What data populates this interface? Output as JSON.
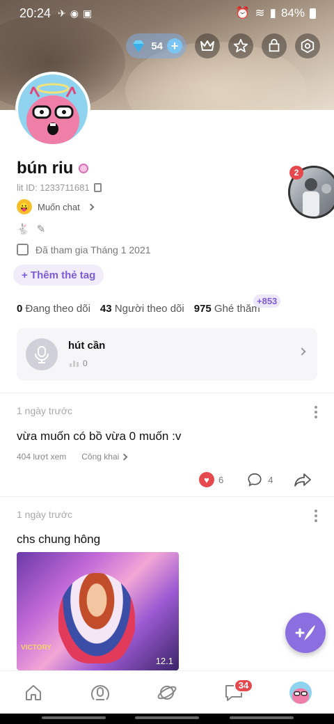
{
  "status_bar": {
    "time": "20:24",
    "battery": "84%"
  },
  "header": {
    "gems": "54"
  },
  "profile": {
    "name": "bún riu",
    "lit_id": "lit ID: 1233711681",
    "mood": "Muốn chat",
    "joined": "Đã tham gia Tháng 1 2021",
    "tag_button": "+ Thêm thẻ tag",
    "stats": {
      "following_count": "0",
      "following_label": "Đang theo dõi",
      "followers_count": "43",
      "followers_label": "Người theo dõi",
      "visits_count": "975",
      "visits_label": "Ghé thăm",
      "visits_new": "+853"
    },
    "story_count": "2"
  },
  "voice": {
    "title": "hút cần",
    "plays": "0"
  },
  "posts": [
    {
      "time": "1 ngày trước",
      "text": "vừa muốn có bồ vừa 0 muốn :v",
      "views": "404 lượt xem",
      "visibility": "Công khai",
      "likes": "6",
      "comments": "4"
    },
    {
      "time": "1 ngày trước",
      "text": "chs chung hông",
      "image_caption": "VICTORY",
      "image_score": "12.1"
    }
  ],
  "bottom_nav": {
    "chat_badge": "34"
  },
  "colors": {
    "accent": "#8b6fe0",
    "badge": "#e5484d",
    "gems": "#7cc4f2"
  }
}
